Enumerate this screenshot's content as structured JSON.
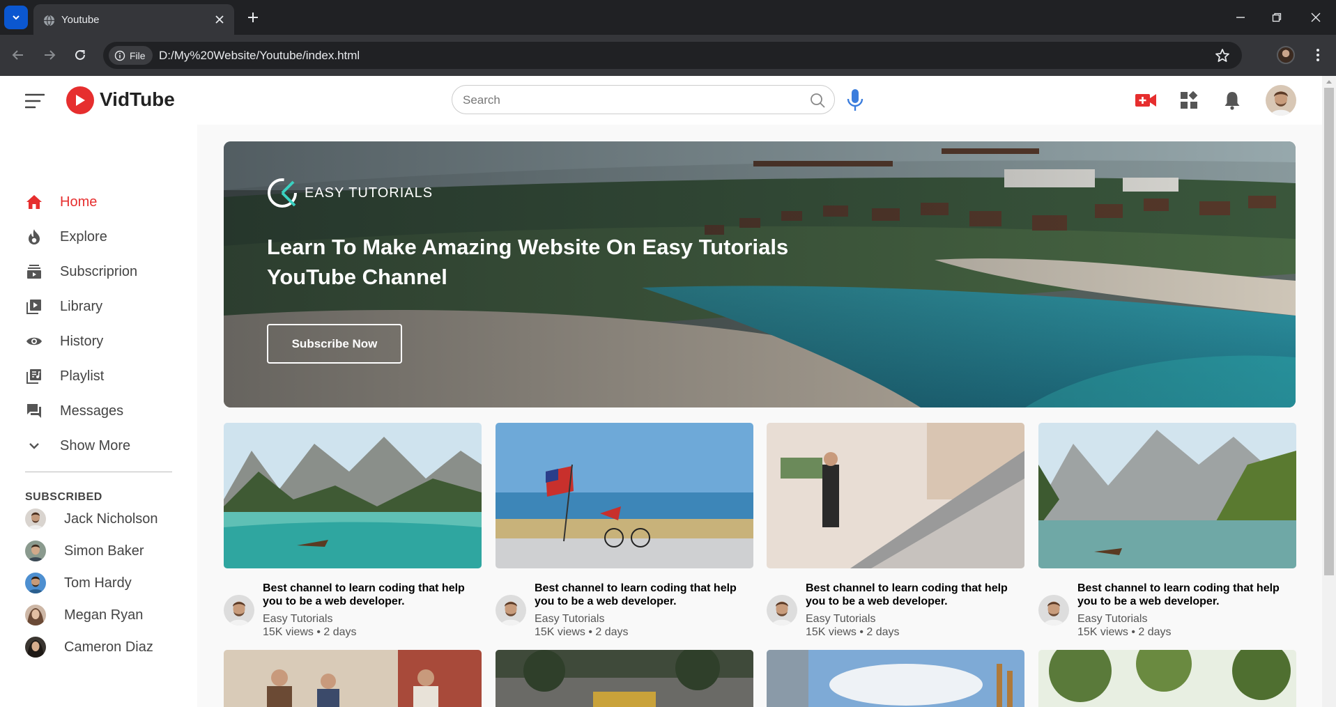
{
  "browser": {
    "tab_title": "Youtube",
    "site_chip_label": "File",
    "url": "D:/My%20Website/Youtube/index.html"
  },
  "navbar": {
    "logo_text": "VidTube",
    "search_placeholder": "Search"
  },
  "sidebar": {
    "items": [
      {
        "label": "Home",
        "icon": "home-icon",
        "active": true
      },
      {
        "label": "Explore",
        "icon": "explore-icon"
      },
      {
        "label": "Subscriprion",
        "icon": "subscription-icon"
      },
      {
        "label": "Library",
        "icon": "library-icon"
      },
      {
        "label": "History",
        "icon": "history-icon"
      },
      {
        "label": "Playlist",
        "icon": "playlist-icon"
      },
      {
        "label": "Messages",
        "icon": "messages-icon"
      },
      {
        "label": "Show More",
        "icon": "chevron-down-icon"
      }
    ],
    "subscribed_heading": "SUBSCRIBED",
    "subscriptions": [
      {
        "name": "Jack Nicholson"
      },
      {
        "name": "Simon Baker"
      },
      {
        "name": "Tom Hardy"
      },
      {
        "name": "Megan Ryan"
      },
      {
        "name": "Cameron Diaz"
      }
    ]
  },
  "banner": {
    "brand": "EASY TUTORIALS",
    "title": "Learn To Make Amazing Website On Easy Tutorials YouTube Channel",
    "button_label": "Subscribe Now"
  },
  "videos": [
    {
      "title": "Best channel to learn coding that help you to be a web developer.",
      "channel": "Easy Tutorials",
      "meta": "15K views • 2 days"
    },
    {
      "title": "Best channel to learn coding that help you to be a web developer.",
      "channel": "Easy Tutorials",
      "meta": "15K views • 2 days"
    },
    {
      "title": "Best channel to learn coding that help you to be a web developer.",
      "channel": "Easy Tutorials",
      "meta": "15K views • 2 days"
    },
    {
      "title": "Best channel to learn coding that help you to be a web developer.",
      "channel": "Easy Tutorials",
      "meta": "15K views • 2 days"
    }
  ],
  "colors": {
    "accent": "#e62e2e",
    "browser_frame": "#202124",
    "browser_toolbar": "#35363a",
    "mic": "#3b7ddd"
  }
}
